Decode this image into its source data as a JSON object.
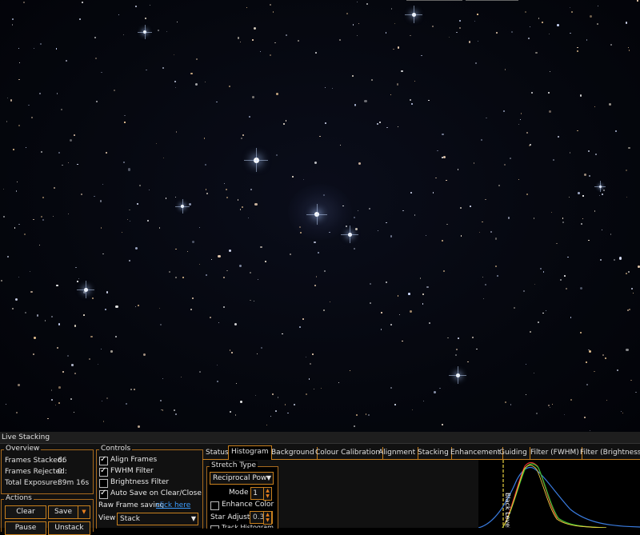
{
  "panel": {
    "title": "Live Stacking",
    "overview": {
      "title": "Overview",
      "frames_stacked_label": "Frames Stacked:",
      "frames_stacked": "66",
      "frames_rejected_label": "Frames Rejected:",
      "frames_rejected": "0",
      "total_exposure_label": "Total Exposure:",
      "total_exposure": "89m 16s"
    },
    "actions": {
      "title": "Actions",
      "clear": "Clear",
      "save": "Save",
      "save_dropdown": "▼",
      "pause": "Pause",
      "unstack": "Unstack"
    },
    "controls": {
      "title": "Controls",
      "align_frames": "Align Frames",
      "align_frames_checked": true,
      "fwhm_filter": "FWHM Filter",
      "fwhm_filter_checked": true,
      "brightness_filter": "Brightness Filter",
      "brightness_filter_checked": false,
      "auto_save": "Auto Save on Clear/Close",
      "auto_save_checked": true,
      "raw_frame_label": "Raw Frame saving",
      "raw_frame_link": "click here",
      "view_label": "View",
      "view_value": "Stack"
    },
    "tabs": [
      {
        "label": "Status",
        "active": false
      },
      {
        "label": "Histogram",
        "active": true
      },
      {
        "label": "Background",
        "active": false
      },
      {
        "label": "Colour Calibration",
        "active": false
      },
      {
        "label": "Alignment",
        "active": false
      },
      {
        "label": "Stacking",
        "active": false
      },
      {
        "label": "Enhancement",
        "active": false
      },
      {
        "label": "Guiding",
        "active": false
      },
      {
        "label": "Filter (FWHM)",
        "active": false
      },
      {
        "label": "Filter (Brightness)",
        "active": false
      }
    ],
    "stretch": {
      "title": "Stretch Type",
      "type_value": "Reciprocal Pow",
      "mode_label": "Mode",
      "mode_value": "1",
      "enhance_color": "Enhance Color",
      "enhance_color_checked": false,
      "star_adjust_label": "Star Adjust",
      "star_adjust_value": "0.30",
      "track_histogram": "Track Histogram"
    },
    "histogram": {
      "black_level_label": "Black Level",
      "colors": {
        "red": "#e03030",
        "green": "#30c030",
        "blue": "#3a7ce0",
        "yellow": "#e8d040",
        "marker": "#e8d040"
      }
    }
  },
  "colors": {
    "accent": "#c8801e",
    "link": "#3c9dff",
    "background": "#111111"
  }
}
